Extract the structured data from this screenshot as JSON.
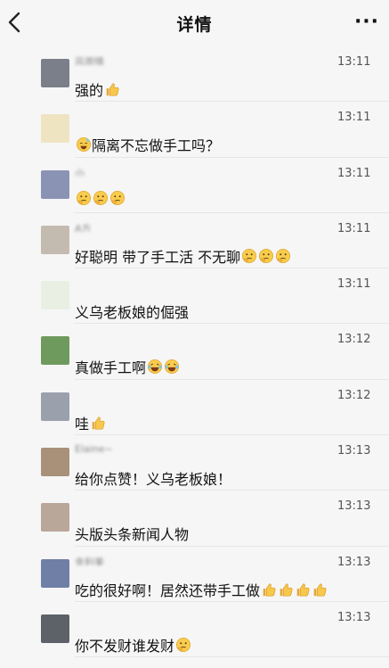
{
  "header": {
    "title": "详情",
    "back_icon": "chevron-left-icon",
    "more_label": "···"
  },
  "comments": [
    {
      "nick": "风雨情",
      "time": "13:11",
      "text": "强的",
      "avatar": "#7b7f8a",
      "emojis": [
        "thumbs-up-icon"
      ]
    },
    {
      "nick": "",
      "time": "13:11",
      "text": "隔离不忘做手工吗？",
      "avatar": "#efe4c2",
      "prefix": "sweat-smile-icon",
      "emojis": []
    },
    {
      "nick": "小",
      "time": "13:11",
      "text": "",
      "avatar": "#8b93b4",
      "emojis": [
        "thinking-face-icon",
        "thinking-face-icon",
        "thinking-face-icon"
      ]
    },
    {
      "nick": "A方",
      "time": "13:11",
      "text": "好聪明 带了手工活 不无聊",
      "avatar": "#c4bbb0",
      "emojis": [
        "thinking-face-icon",
        "thinking-face-icon",
        "thinking-face-icon"
      ]
    },
    {
      "nick": "",
      "time": "13:11",
      "text": "义乌老板娘的倔强",
      "avatar": "#e9efe3",
      "emojis": []
    },
    {
      "nick": "",
      "time": "13:12",
      "text": "真做手工啊",
      "avatar": "#6f9a5e",
      "emojis": [
        "laughing-tears-icon",
        "laughing-tears-icon"
      ]
    },
    {
      "nick": "",
      "time": "13:12",
      "text": "哇",
      "avatar": "#9ba0ad",
      "emojis": [
        "thumbs-up-icon"
      ]
    },
    {
      "nick": "Elaine~",
      "time": "13:13",
      "text": "给你点赞！义乌老板娘！",
      "avatar": "#a99079",
      "emojis": []
    },
    {
      "nick": "",
      "time": "13:13",
      "text": "头版头条新闻人物",
      "avatar": "#b9a79a",
      "emojis": []
    },
    {
      "nick": "金利美",
      "time": "13:13",
      "text": "吃的很好啊！居然还带手工做",
      "avatar": "#6f7fa6",
      "emojis": [
        "thumbs-up-icon",
        "thumbs-up-icon",
        "thumbs-up-icon",
        "thumbs-up-icon"
      ]
    },
    {
      "nick": "",
      "time": "13:13",
      "text": "你不发财谁发财",
      "avatar": "#5d6268",
      "emojis": [
        "thinking-face-icon"
      ]
    }
  ]
}
